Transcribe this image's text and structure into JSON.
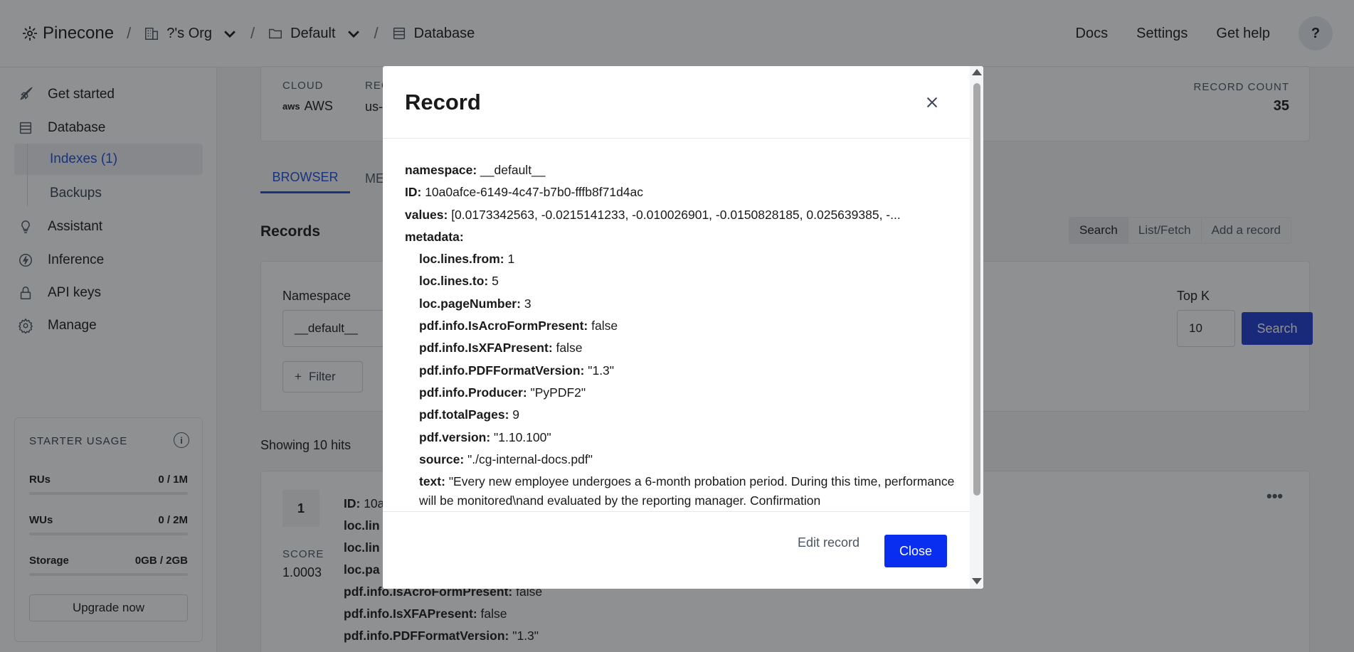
{
  "topbar": {
    "logo_text": "Pinecone",
    "org_label": "?'s Org",
    "project_label": "Default",
    "database_label": "Database",
    "links": [
      "Docs",
      "Settings",
      "Get help"
    ],
    "help_glyph": "?"
  },
  "sidebar": {
    "items": [
      {
        "label": "Get started",
        "icon": "rocket-icon"
      },
      {
        "label": "Database",
        "icon": "database-icon"
      },
      {
        "label": "Assistant",
        "icon": "lightbulb-icon"
      },
      {
        "label": "Inference",
        "icon": "lightning-icon"
      },
      {
        "label": "API keys",
        "icon": "lock-icon"
      },
      {
        "label": "Manage",
        "icon": "gear-icon"
      }
    ],
    "sub_items": [
      {
        "label": "Indexes (1)",
        "active": true
      },
      {
        "label": "Backups",
        "active": false
      }
    ],
    "usage": {
      "title": "STARTER USAGE",
      "rows": [
        {
          "label": "RUs",
          "value": "0 / 1M"
        },
        {
          "label": "WUs",
          "value": "0 / 2M"
        },
        {
          "label": "Storage",
          "value": "0GB / 2GB"
        }
      ],
      "upgrade_label": "Upgrade now"
    }
  },
  "main": {
    "cloud_label": "CLOUD",
    "cloud_value": "AWS",
    "cloud_logo": "aws",
    "region_label": "REG",
    "region_value": "us-",
    "record_count_label": "RECORD COUNT",
    "record_count_value": "35",
    "tabs": [
      "BROWSER",
      "ME"
    ],
    "records_title": "Records",
    "modes": [
      "Search",
      "List/Fetch",
      "Add a record"
    ],
    "namespace_label": "Namespace",
    "namespace_value": "__default__",
    "topk_label": "Top K",
    "topk_value": "10",
    "search_button": "Search",
    "filter_button": "Filter",
    "hits_text": "Showing 10 hits",
    "result": {
      "rank": "1",
      "score_label": "SCORE",
      "score_value": "1.0003",
      "lines": [
        {
          "k": "ID:",
          "v": "10a"
        },
        {
          "k": "loc.lin",
          "v": ""
        },
        {
          "k": "loc.lin",
          "v": ""
        },
        {
          "k": "loc.pa",
          "v": ""
        },
        {
          "k": "pdf.info.IsAcroFormPresent:",
          "v": "false"
        },
        {
          "k": "pdf.info.IsXFAPresent:",
          "v": "false"
        },
        {
          "k": "pdf.info.PDFFormatVersion:",
          "v": "\"1.3\""
        }
      ]
    }
  },
  "modal": {
    "title": "Record",
    "fields": [
      {
        "k": "namespace:",
        "v": "__default__",
        "indent": false
      },
      {
        "k": "ID:",
        "v": "10a0afce-6149-4c47-b7b0-fffb8f71d4ac",
        "indent": false
      },
      {
        "k": "values:",
        "v": "[0.0173342563, -0.0215141233, -0.010026901, -0.0150828185, 0.025639385, -...",
        "indent": false
      },
      {
        "k": "metadata:",
        "v": "",
        "indent": false
      },
      {
        "k": "loc.lines.from:",
        "v": "1",
        "indent": true
      },
      {
        "k": "loc.lines.to:",
        "v": "5",
        "indent": true
      },
      {
        "k": "loc.pageNumber:",
        "v": "3",
        "indent": true
      },
      {
        "k": "pdf.info.IsAcroFormPresent:",
        "v": "false",
        "indent": true
      },
      {
        "k": "pdf.info.IsXFAPresent:",
        "v": "false",
        "indent": true
      },
      {
        "k": "pdf.info.PDFFormatVersion:",
        "v": "\"1.3\"",
        "indent": true
      },
      {
        "k": "pdf.info.Producer:",
        "v": "\"PyPDF2\"",
        "indent": true
      },
      {
        "k": "pdf.totalPages:",
        "v": "9",
        "indent": true
      },
      {
        "k": "pdf.version:",
        "v": "\"1.10.100\"",
        "indent": true
      },
      {
        "k": "source:",
        "v": "\"./cg-internal-docs.pdf\"",
        "indent": true
      },
      {
        "k": "text:",
        "v": "\"Every new employee undergoes a 6-month probation period. During this time, performance will be monitored\\nand evaluated by the reporting manager. Confirmation",
        "indent": true
      }
    ],
    "edit_label": "Edit record",
    "close_label": "Close"
  }
}
